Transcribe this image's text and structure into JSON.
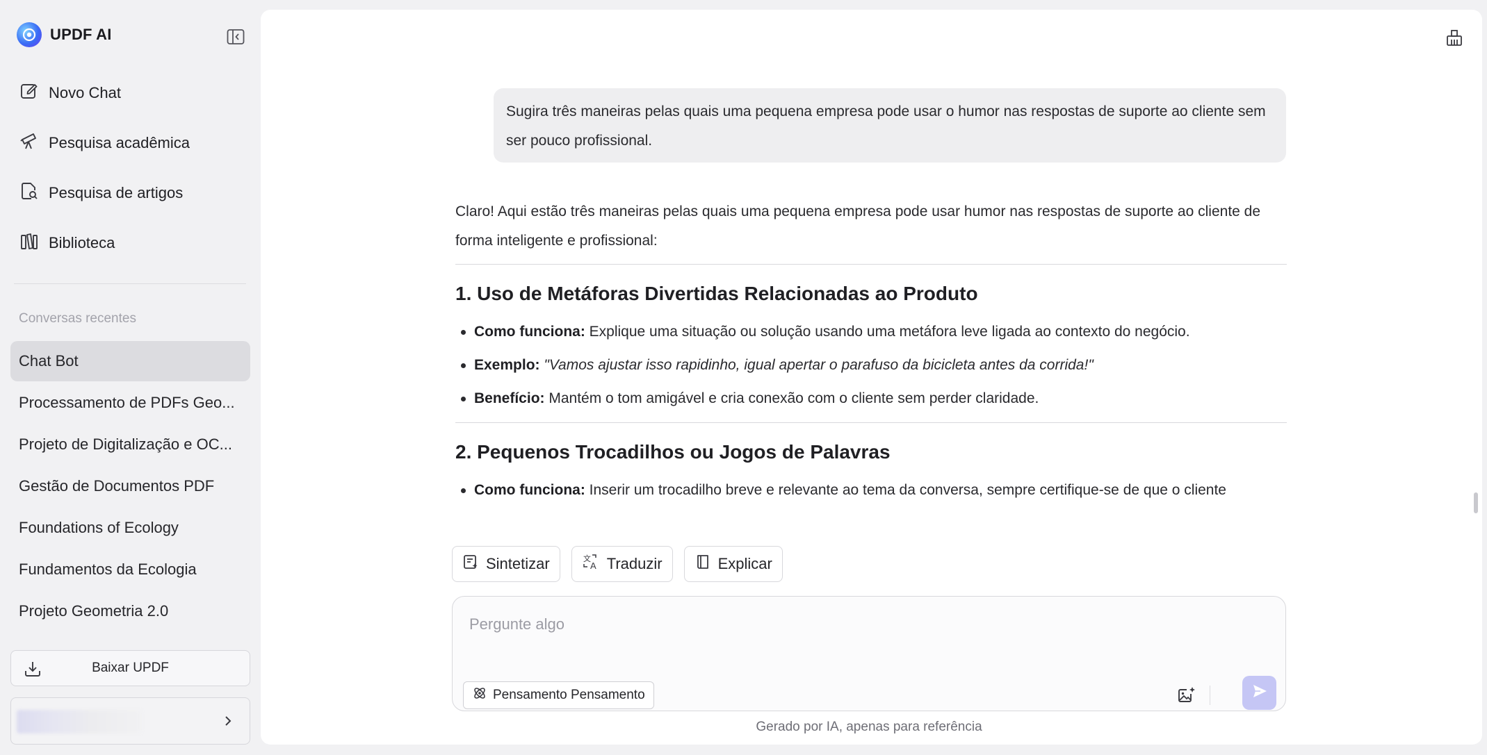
{
  "brand": {
    "name": "UPDF AI",
    "logo_icon": "updf-ai-logo-icon"
  },
  "sidebar": {
    "nav": [
      {
        "label": "Novo Chat",
        "icon": "new-chat-icon"
      },
      {
        "label": "Pesquisa acadêmica",
        "icon": "telescope-icon"
      },
      {
        "label": "Pesquisa de artigos",
        "icon": "document-search-icon"
      },
      {
        "label": "Biblioteca",
        "icon": "library-icon"
      }
    ],
    "recent_title": "Conversas recentes",
    "conversations": [
      {
        "label": "Chat Bot",
        "active": true
      },
      {
        "label": "Processamento de PDFs Geo...",
        "active": false
      },
      {
        "label": "Projeto de Digitalização e OC...",
        "active": false
      },
      {
        "label": "Gestão de Documentos PDF",
        "active": false
      },
      {
        "label": "Foundations of Ecology",
        "active": false
      },
      {
        "label": "Fundamentos da Ecologia",
        "active": false
      },
      {
        "label": "Projeto Geometria 2.0",
        "active": false
      }
    ],
    "download_label": "Baixar UPDF"
  },
  "chat": {
    "user_message": "Sugira três maneiras pelas quais uma pequena empresa pode usar o humor nas respostas de suporte ao cliente sem ser pouco profissional.",
    "answer_intro": "Claro! Aqui estão três maneiras pelas quais uma pequena empresa pode usar humor nas respostas de suporte ao cliente de forma inteligente e profissional:",
    "sections": [
      {
        "heading": "1. Uso de Metáforas Divertidas Relacionadas ao Produto",
        "bullets": [
          {
            "label": "Como funciona:",
            "text": " Explique uma situação ou solução usando uma metáfora leve ligada ao contexto do negócio.",
            "italic": false
          },
          {
            "label": "Exemplo:",
            "text": "\"Vamos ajustar isso rapidinho, igual apertar o parafuso da bicicleta antes da corrida!\"",
            "italic": true
          },
          {
            "label": "Benefício:",
            "text": " Mantém o tom amigável e cria conexão com o cliente sem perder claridade.",
            "italic": false
          }
        ]
      },
      {
        "heading": "2. Pequenos Trocadilhos ou Jogos de Palavras",
        "bullets": [
          {
            "label": "Como funciona:",
            "text": " Inserir um trocadilho breve e relevante ao tema da conversa, sempre certifique-se de que o cliente",
            "italic": false
          }
        ]
      }
    ]
  },
  "actions": {
    "summarize": "Sintetizar",
    "translate": "Traduzir",
    "explain": "Explicar"
  },
  "composer": {
    "placeholder": "Pergunte algo",
    "value": "",
    "thinking_label": "Pensamento Pensamento"
  },
  "footer_note": "Gerado por IA, apenas para referência",
  "colors": {
    "sidebar_bg": "#f1f1f3",
    "active_item_bg": "#dcdce0",
    "send_button": "#c5c6f5",
    "user_bubble": "#eeeef0"
  }
}
